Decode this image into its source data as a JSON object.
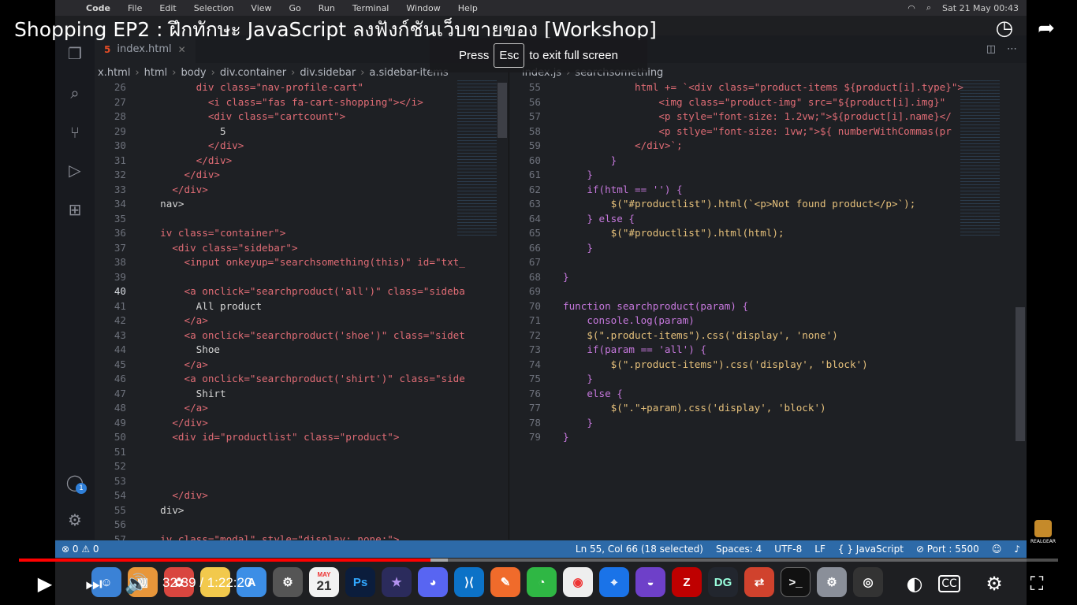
{
  "video": {
    "title": "Shopping EP2 : ฝึกทักษะ JavaScript ลงฟังก์ชันเว็บขายของ [Workshop]",
    "exit_hint_press": "Press",
    "exit_hint_key": "Esc",
    "exit_hint_rest": "to exit full screen",
    "time_label": "32:39 / 1:22:20",
    "progress_fraction": 0.396,
    "buffered_fraction": 0.413,
    "channel_watermark": "REALGEAR"
  },
  "menubar": {
    "items": [
      "Code",
      "File",
      "Edit",
      "Selection",
      "View",
      "Go",
      "Run",
      "Terminal",
      "Window",
      "Help"
    ],
    "clock": "Sat 21 May  00:43"
  },
  "left_editor": {
    "tab": "index.html",
    "breadcrumb": [
      "x.html",
      "html",
      "body",
      "div.container",
      "div.sidebar",
      "a.sidebar-items"
    ],
    "lines": [
      {
        "n": "26",
        "t": "        div class=\"nav-profile-cart\""
      },
      {
        "n": "27",
        "t": "          <i class=\"fas fa-cart-shopping\"></i>"
      },
      {
        "n": "28",
        "t": "          <div class=\"cartcount\">"
      },
      {
        "n": "29",
        "t": "            5"
      },
      {
        "n": "30",
        "t": "          </div>"
      },
      {
        "n": "31",
        "t": "        </div>"
      },
      {
        "n": "32",
        "t": "      </div>"
      },
      {
        "n": "33",
        "t": "    </div>"
      },
      {
        "n": "34",
        "t": "  nav>"
      },
      {
        "n": "35",
        "t": ""
      },
      {
        "n": "36",
        "t": "  iv class=\"container\">"
      },
      {
        "n": "37",
        "t": "    <div class=\"sidebar\">"
      },
      {
        "n": "38",
        "t": "      <input onkeyup=\"searchsomething(this)\" id=\"txt_"
      },
      {
        "n": "39",
        "t": ""
      },
      {
        "n": "40",
        "t": "      <a onclick=\"searchproduct('all')\" class=\"sideba"
      },
      {
        "n": "41",
        "t": "        All product"
      },
      {
        "n": "42",
        "t": "      </a>"
      },
      {
        "n": "43",
        "t": "      <a onclick=\"searchproduct('shoe')\" class=\"sidet"
      },
      {
        "n": "44",
        "t": "        Shoe"
      },
      {
        "n": "45",
        "t": "      </a>"
      },
      {
        "n": "46",
        "t": "      <a onclick=\"searchproduct('shirt')\" class=\"side"
      },
      {
        "n": "47",
        "t": "        Shirt"
      },
      {
        "n": "48",
        "t": "      </a>"
      },
      {
        "n": "49",
        "t": "    </div>"
      },
      {
        "n": "50",
        "t": "    <div id=\"productlist\" class=\"product\">"
      },
      {
        "n": "51",
        "t": ""
      },
      {
        "n": "52",
        "t": ""
      },
      {
        "n": "53",
        "t": ""
      },
      {
        "n": "54",
        "t": "    </div>"
      },
      {
        "n": "55",
        "t": "  div>"
      },
      {
        "n": "56",
        "t": ""
      },
      {
        "n": "57",
        "t": "  iv class=\"modal\" style=\"display: none;\">"
      }
    ]
  },
  "right_editor": {
    "tab": "index.js",
    "breadcrumb": [
      "index.js",
      "searchsomething"
    ],
    "lines": [
      {
        "n": "55",
        "t": "            html += `<div class=\"product-items ${product[i].type}\">"
      },
      {
        "n": "56",
        "t": "                <img class=\"product-img\" src=\"${product[i].img}\""
      },
      {
        "n": "57",
        "t": "                <p style=\"font-size: 1.2vw;\">${product[i].name}</"
      },
      {
        "n": "58",
        "t": "                <p stlye=\"font-size: 1vw;\">${ numberWithCommas(pr"
      },
      {
        "n": "59",
        "t": "            </div>`;"
      },
      {
        "n": "60",
        "t": "        }"
      },
      {
        "n": "61",
        "t": "    }"
      },
      {
        "n": "62",
        "t": "    if(html == '') {"
      },
      {
        "n": "63",
        "t": "        $(\"#productlist\").html(`<p>Not found product</p>`);"
      },
      {
        "n": "64",
        "t": "    } else {"
      },
      {
        "n": "65",
        "t": "        $(\"#productlist\").html(html);"
      },
      {
        "n": "66",
        "t": "    }"
      },
      {
        "n": "67",
        "t": ""
      },
      {
        "n": "68",
        "t": "}"
      },
      {
        "n": "69",
        "t": ""
      },
      {
        "n": "70",
        "t": "function searchproduct(param) {"
      },
      {
        "n": "71",
        "t": "    console.log(param)"
      },
      {
        "n": "72",
        "t": "    $(\".product-items\").css('display', 'none')"
      },
      {
        "n": "73",
        "t": "    if(param == 'all') {"
      },
      {
        "n": "74",
        "t": "        $(\".product-items\").css('display', 'block')"
      },
      {
        "n": "75",
        "t": "    }"
      },
      {
        "n": "76",
        "t": "    else {"
      },
      {
        "n": "77",
        "t": "        $(\".\"+param).css('display', 'block')"
      },
      {
        "n": "78",
        "t": "    }"
      },
      {
        "n": "79",
        "t": "}"
      }
    ]
  },
  "statusbar": {
    "errors": "⊗ 0 ⚠ 0",
    "position": "Ln 55, Col 66 (18 selected)",
    "spaces": "Spaces: 4",
    "encoding": "UTF-8",
    "eol": "LF",
    "language": "{ } JavaScript",
    "port": "⊘ Port : 5500"
  },
  "dock": {
    "calendar_month": "MAY",
    "calendar_day": "21",
    "ps": "Ps",
    "dg": "DG",
    "badge": "1"
  },
  "activity_badge": "1",
  "colors": {
    "progress": "#ff0000",
    "statusbar": "#2d6aa8",
    "editor_bg": "#1e2024"
  }
}
